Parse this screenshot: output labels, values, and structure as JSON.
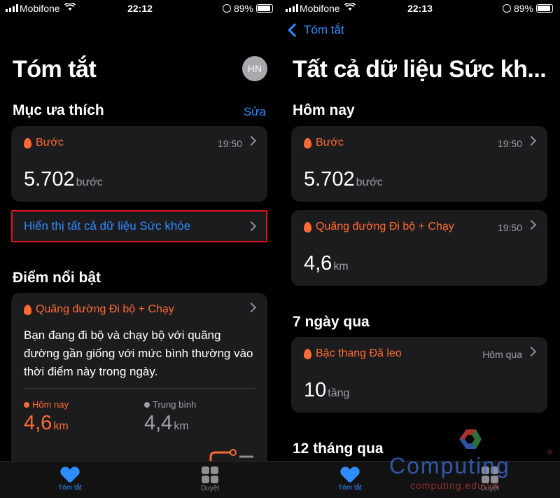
{
  "status": {
    "carrier": "Mobifone",
    "battery": "89%",
    "time_left": "22:12",
    "time_right": "22:13"
  },
  "left": {
    "title": "Tóm tắt",
    "avatar": "HN",
    "favorites_heading": "Mục ưa thích",
    "edit_label": "Sửa",
    "steps_card": {
      "label": "Bước",
      "time": "19:50",
      "value": "5.702",
      "unit": "bước"
    },
    "show_all_label": "Hiển thị tất cả dữ liệu Sức khỏe",
    "highlights_heading": "Điểm nổi bật",
    "highlight_card": {
      "label": "Quãng đường Đi bộ + Chạy",
      "text": "Bạn đang đi bộ và chạy bộ với quãng đường gần giống với mức bình thường vào thời điểm này trong ngày.",
      "today_label": "Hôm nay",
      "today_value": "4,6",
      "today_unit": "km",
      "avg_label": "Trung bình",
      "avg_value": "4,4",
      "avg_unit": "km"
    }
  },
  "right": {
    "back_label": "Tóm tắt",
    "title": "Tất cả dữ liệu Sức kh...",
    "today_heading": "Hôm nay",
    "steps_card": {
      "label": "Bước",
      "time": "19:50",
      "value": "5.702",
      "unit": "bước"
    },
    "distance_card": {
      "label": "Quãng đường Đi bộ + Chạy",
      "time": "19:50",
      "value": "4,6",
      "unit": "km"
    },
    "week_heading": "7 ngày qua",
    "stairs_card": {
      "label": "Bậc thang Đã leo",
      "time": "Hôm qua",
      "value": "10",
      "unit": "tầng"
    },
    "year_heading": "12 tháng qua"
  },
  "tabs": {
    "summary": "Tóm tắt",
    "browse": "Duyệt"
  },
  "watermark": {
    "brand": "Computing",
    "site": "computing.edu.vn"
  },
  "colors": {
    "accent_orange": "#ff6a33",
    "link_blue": "#2f8cff",
    "highlight_red": "#e0141e"
  },
  "icons": [
    "flame-icon",
    "chevron-right-icon",
    "heart-icon",
    "grid-icon",
    "wifi-icon"
  ]
}
